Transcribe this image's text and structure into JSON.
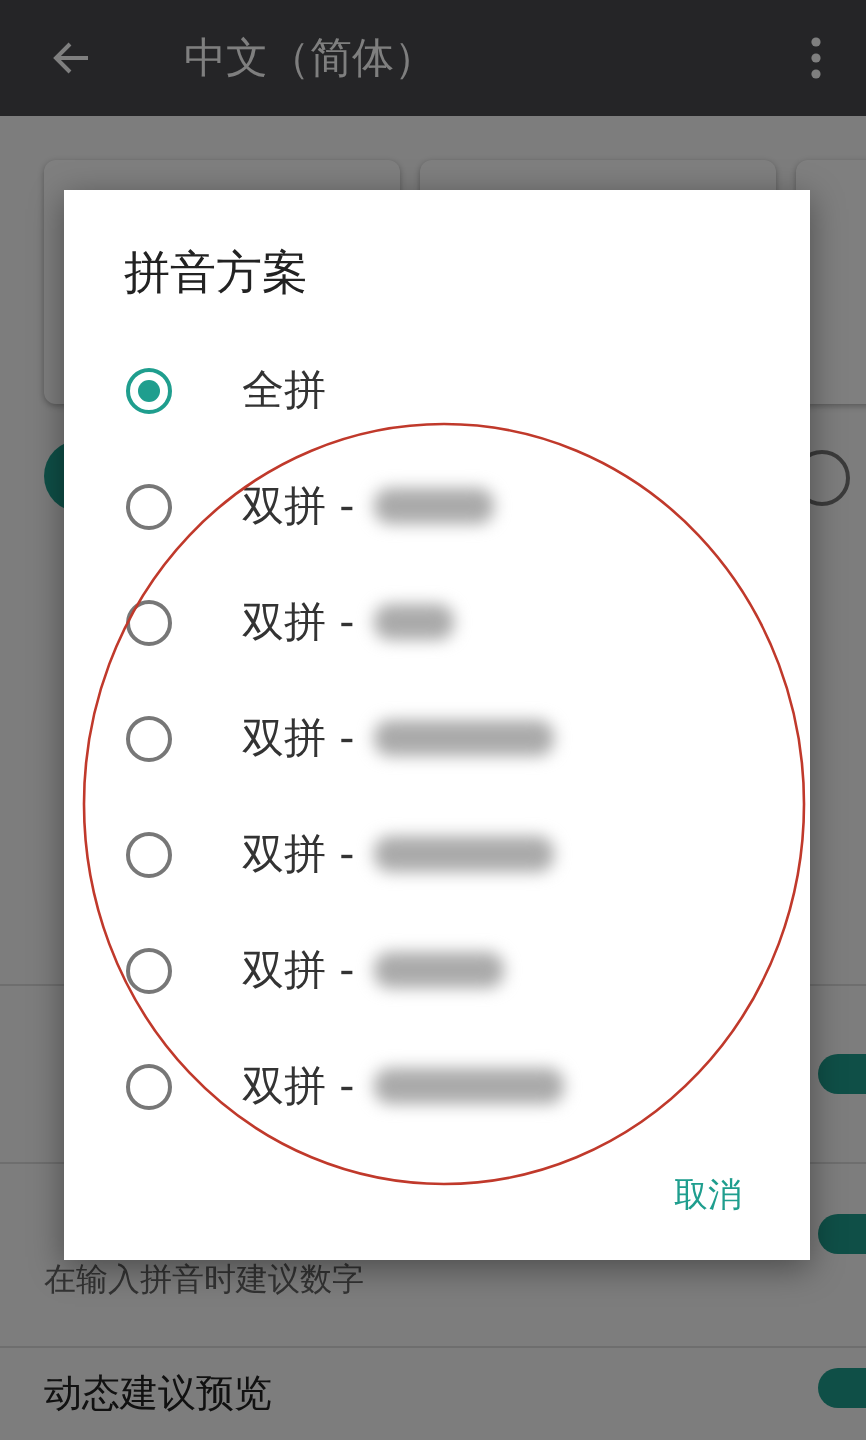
{
  "app_bar": {
    "title": "中文（简体）"
  },
  "background": {
    "radios": [
      {
        "selected": true
      },
      {
        "selected": false
      }
    ],
    "items": [
      {
        "on": true
      },
      {
        "subtitle": "在输入拼音时建议数字",
        "on": true
      },
      {
        "title": "动态建议预览",
        "on": true
      }
    ]
  },
  "dialog": {
    "title": "拼音方案",
    "options": [
      {
        "label": "全拼",
        "selected": true
      },
      {
        "label": "双拼 -",
        "selected": false
      },
      {
        "label": "双拼 -",
        "selected": false
      },
      {
        "label": "双拼 -",
        "selected": false
      },
      {
        "label": "双拼 -",
        "selected": false
      },
      {
        "label": "双拼 -",
        "selected": false
      },
      {
        "label": "双拼 -",
        "selected": false
      }
    ],
    "cancel": "取消"
  }
}
